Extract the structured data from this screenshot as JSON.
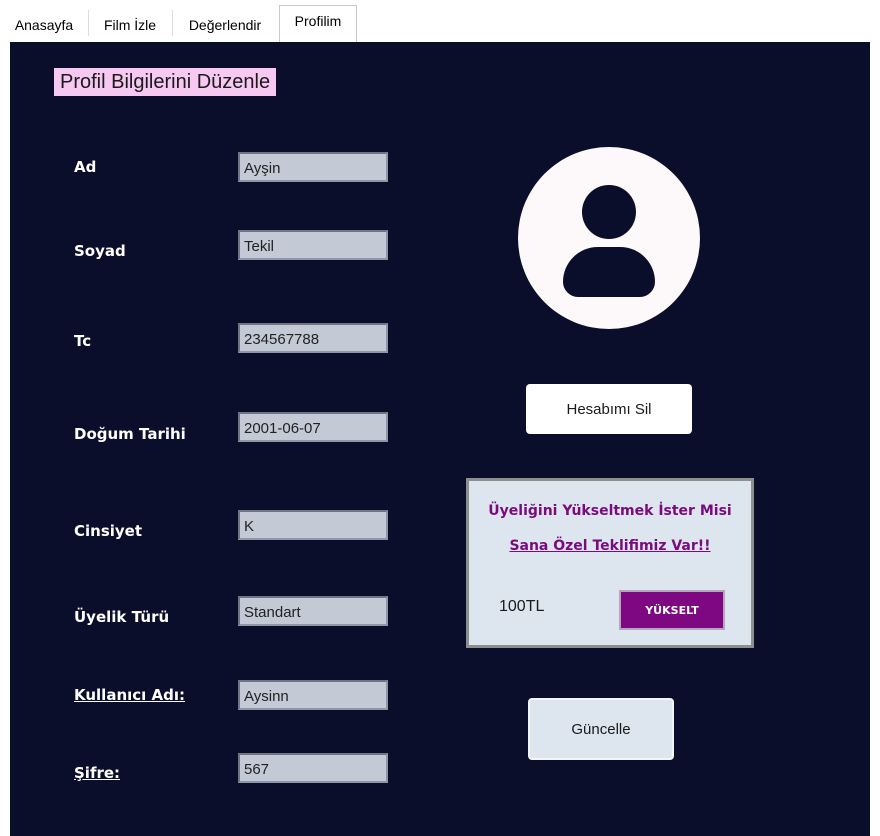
{
  "tabs": [
    {
      "label": "Anasayfa"
    },
    {
      "label": "Film İzle"
    },
    {
      "label": "Değerlendir"
    },
    {
      "label": "Profilim"
    }
  ],
  "page_title": "Profil Bilgilerini Düzenle",
  "form": {
    "ad": {
      "label": "Ad",
      "value": "Ayşin"
    },
    "soyad": {
      "label": "Soyad",
      "value": "Tekil"
    },
    "tc": {
      "label": "Tc",
      "value": "234567788"
    },
    "dogum_tarihi": {
      "label": "Doğum Tarihi",
      "value": "2001-06-07"
    },
    "cinsiyet": {
      "label": "Cinsiyet",
      "value": "K"
    },
    "uyelik_turu": {
      "label": "Üyelik Türü",
      "value": "Standart"
    },
    "kullanici_adi": {
      "label": "Kullanıcı Adı:",
      "value": "Aysinn"
    },
    "sifre": {
      "label": "Şifre:",
      "value": "567"
    }
  },
  "actions": {
    "delete_label": "Hesabımı Sil",
    "update_label": "Güncelle"
  },
  "promo": {
    "line1": "Üyeliğini Yükseltmek İster Misi",
    "line2": "Sana Özel Teklifimiz Var!!",
    "price": "100TL",
    "upgrade_label": "YÜKSELT"
  },
  "colors": {
    "panel_bg": "#0a0e2b",
    "title_bg": "#f6c8f2",
    "accent_purple": "#7e0782",
    "field_bg": "#c3cad6"
  },
  "icons": {
    "avatar": "user-avatar-icon"
  }
}
